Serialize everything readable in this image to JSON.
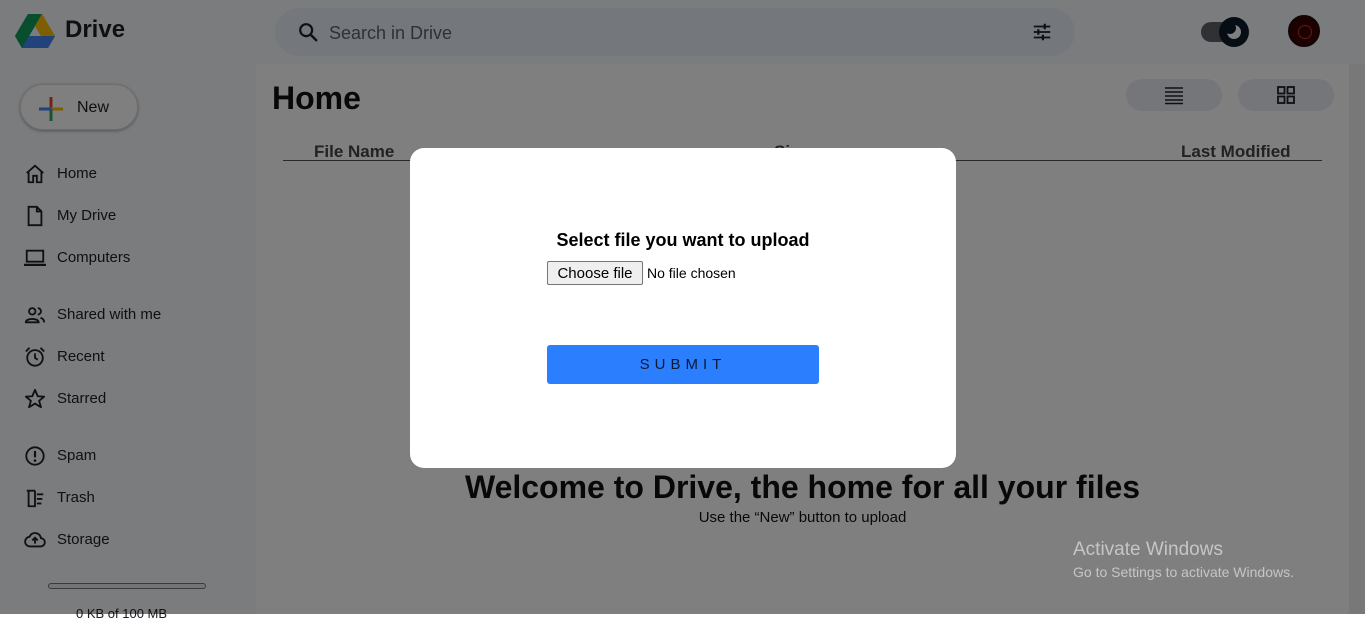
{
  "header": {
    "brand": "Drive",
    "search_placeholder": "Search in Drive"
  },
  "sidebar": {
    "new_label": "New",
    "items": [
      {
        "label": "Home",
        "icon": "home-icon"
      },
      {
        "label": "My Drive",
        "icon": "file-icon"
      },
      {
        "label": "Computers",
        "icon": "laptop-icon"
      },
      {
        "label": "Shared with me",
        "icon": "people-icon"
      },
      {
        "label": "Recent",
        "icon": "clock-icon"
      },
      {
        "label": "Starred",
        "icon": "star-icon"
      },
      {
        "label": "Spam",
        "icon": "alert-circle-icon"
      },
      {
        "label": "Trash",
        "icon": "trash-icon"
      },
      {
        "label": "Storage",
        "icon": "cloud-upload-icon"
      }
    ],
    "storage_text": "0 KB of 100 MB"
  },
  "main": {
    "title": "Home",
    "columns": [
      "File Name",
      "Size",
      "Last Modified"
    ],
    "welcome_title": "Welcome to Drive, the home for all your files",
    "welcome_sub": "Use the “New” button to upload"
  },
  "modal": {
    "title": "Select file you want to upload",
    "choose_label": "Choose file",
    "file_status": "No file chosen",
    "submit_label": "SUBMIT"
  },
  "watermark": {
    "line1": "Activate Windows",
    "line2": "Go to Settings to activate Windows."
  },
  "colors": {
    "accent": "#2b7fff",
    "overlay": "rgba(0,0,0,0.5)",
    "sidebar_bg": "#f7f9fc"
  }
}
